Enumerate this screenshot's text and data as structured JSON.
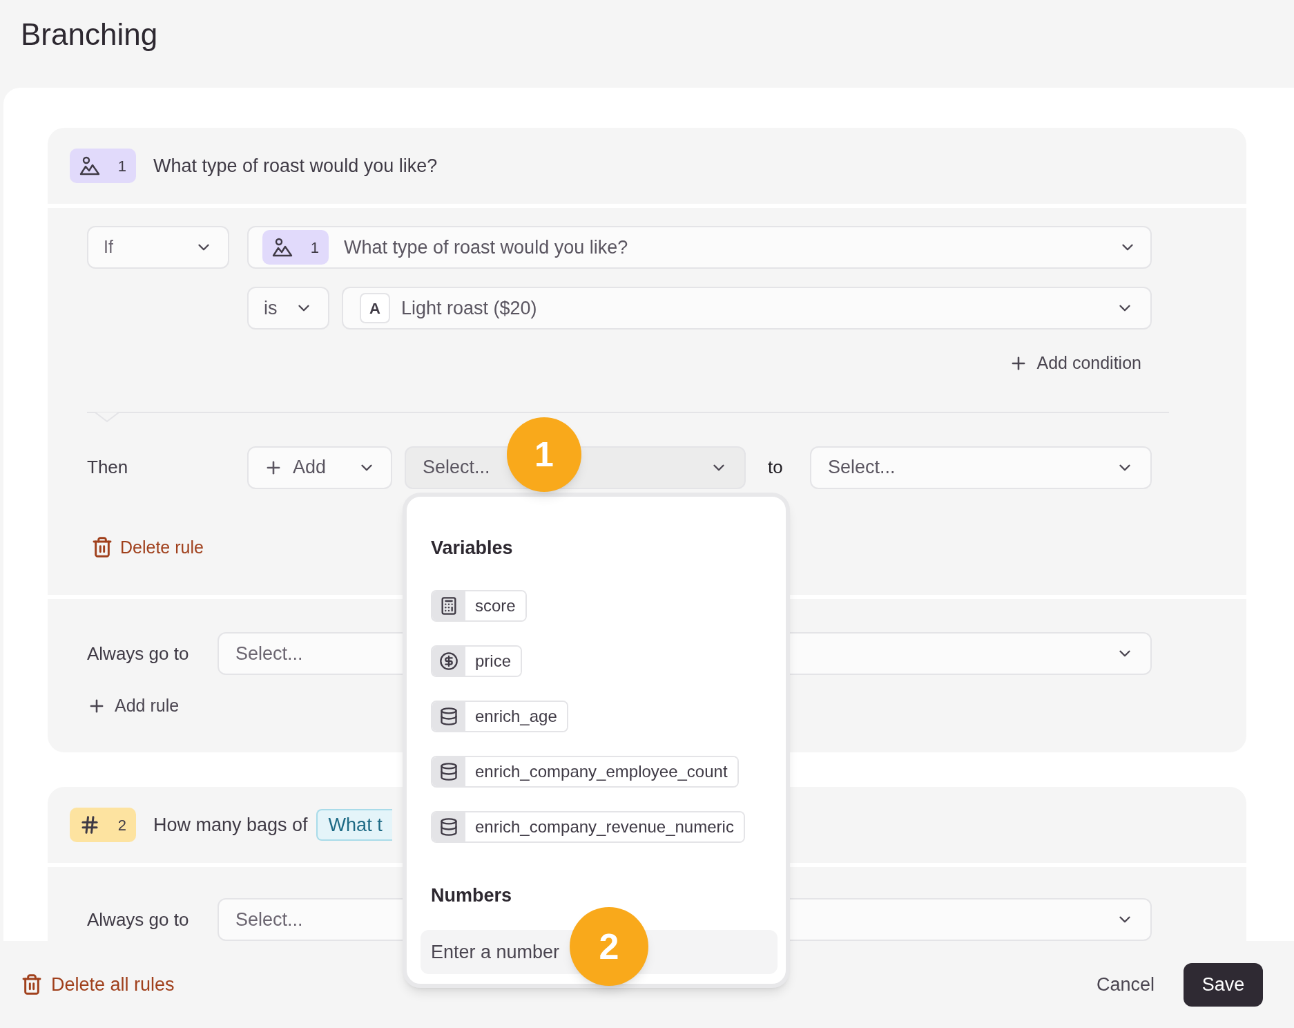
{
  "page": {
    "title": "Branching"
  },
  "blocks": [
    {
      "badge": {
        "kind": "image",
        "number": "1"
      },
      "title": "What type of roast would you like?",
      "rule": {
        "if_op": "If",
        "question": {
          "badge": {
            "kind": "image",
            "number": "1"
          },
          "text": "What type of roast would you like?"
        },
        "comparator": "is",
        "answer": {
          "letter": "A",
          "text": "Light roast ($20)"
        },
        "add_condition": "Add condition",
        "then_label": "Then",
        "action": "Add",
        "target": {
          "placeholder": "Select...",
          "open": true
        },
        "to": "to",
        "value": {
          "placeholder": "Select...",
          "open": false
        },
        "delete": "Delete rule"
      },
      "always_label": "Always go to",
      "always_placeholder": "Select...",
      "add_rule": "Add rule"
    },
    {
      "badge": {
        "kind": "number",
        "number": "2"
      },
      "title": "How many bags of",
      "chip": "What t",
      "always_label": "Always go to",
      "always_placeholder": "Select..."
    }
  ],
  "dropdown": {
    "sections": [
      {
        "title": "Variables",
        "items": [
          {
            "kind": "calculator",
            "label": "score"
          },
          {
            "kind": "currency",
            "label": "price"
          },
          {
            "kind": "database",
            "label": "enrich_age"
          },
          {
            "kind": "database",
            "label": "enrich_company_employee_count"
          },
          {
            "kind": "database",
            "label": "enrich_company_revenue_numeric"
          }
        ]
      },
      {
        "title": "Numbers",
        "input_placeholder": "Enter a number"
      }
    ]
  },
  "annotations": [
    {
      "label": "1"
    },
    {
      "label": "2"
    }
  ],
  "footer": {
    "delete_all": "Delete all rules",
    "cancel": "Cancel",
    "save": "Save"
  }
}
